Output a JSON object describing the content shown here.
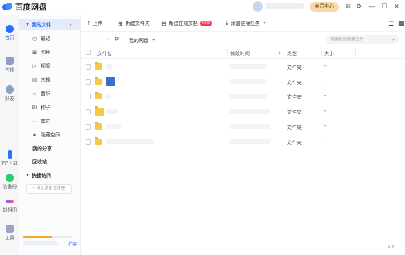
{
  "app": {
    "title": "百度网盘"
  },
  "topbar": {
    "vip_label": "会员中心",
    "mail_icon": "mail-icon",
    "settings_icon": "gear-icon"
  },
  "rail": {
    "items": [
      {
        "label": "首页",
        "icon": "cloud-icon",
        "active": true
      },
      {
        "label": "传输",
        "icon": "transfer-icon"
      },
      {
        "label": "好友",
        "icon": "friends-icon"
      },
      {
        "label": "PP下载",
        "icon": "download-icon"
      },
      {
        "label": "信备份",
        "icon": "wechat-backup-icon"
      },
      {
        "label": "刻相册",
        "icon": "album-icon"
      },
      {
        "label": "工具",
        "icon": "grid-icon"
      }
    ]
  },
  "sidebar": {
    "my_files": "我的文件",
    "items": [
      {
        "label": "最近",
        "icon": "clock-icon"
      },
      {
        "label": "图片",
        "icon": "image-icon"
      },
      {
        "label": "视频",
        "icon": "play-icon"
      },
      {
        "label": "文档",
        "icon": "doc-icon"
      },
      {
        "label": "音乐",
        "icon": "headphone-icon"
      },
      {
        "label": "种子",
        "icon": "seed-icon"
      },
      {
        "label": "其它",
        "icon": "dots-icon"
      },
      {
        "label": "隐藏空间",
        "icon": "lock-icon"
      }
    ],
    "my_share": "我的分享",
    "recycle": "回收站",
    "quick_access": "快捷访问",
    "pin_hint": "+ 拖入常用文件夹",
    "expand": "扩容",
    "storage_used_fraction": 0.6
  },
  "toolbar": {
    "upload": "上传",
    "new_folder": "新建文件夹",
    "new_online_doc": "新建在线文档",
    "new_badge": "NEW",
    "add_link_task": "添加链接任务"
  },
  "nav": {
    "breadcrumb": "我的网盘",
    "breadcrumb_sep": ">",
    "search_placeholder": "搜索我的网盘文件"
  },
  "table": {
    "headers": {
      "name": "文件名",
      "modified": "修改时间",
      "type": "类型",
      "size": "大小"
    },
    "rows": [
      {
        "type": "文件夹",
        "size": "-"
      },
      {
        "type": "文件夹",
        "size": "-"
      },
      {
        "type": "文件夹",
        "size": "-"
      },
      {
        "type": "文件夹",
        "size": "-"
      },
      {
        "type": "文件夹",
        "size": "-"
      },
      {
        "type": "文件夹",
        "size": "-"
      }
    ]
  },
  "footer": {
    "count": "6项"
  }
}
